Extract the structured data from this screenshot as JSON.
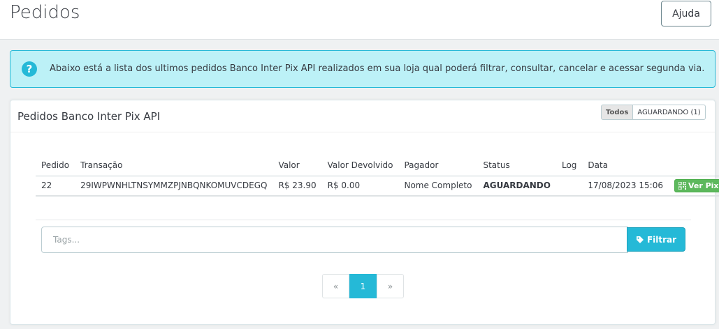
{
  "header": {
    "title": "Pedidos",
    "help_label": "Ajuda"
  },
  "alert": {
    "icon": "question-circle-icon",
    "text": "Abaixo está a lista dos ultimos pedidos Banco Inter Pix API realizados em sua loja qual poderá filtrar, consultar, cancelar e acessar segunda via."
  },
  "panel": {
    "title": "Pedidos Banco Inter Pix API",
    "filters": [
      {
        "label": "Todos",
        "active": true
      },
      {
        "label": "AGUARDANDO (1)",
        "active": false
      }
    ]
  },
  "table": {
    "columns": [
      "Pedido",
      "Transação",
      "Valor",
      "Valor Devolvido",
      "Pagador",
      "Status",
      "Log",
      "Data",
      ""
    ],
    "rows": [
      {
        "pedido": "22",
        "transacao": "29IWPWNHLTNSYMMZPJNBQNKOMUVCDEGQ",
        "valor": "R$ 23.90",
        "valor_devolvido": "R$ 0.00",
        "pagador": "Nome Completo",
        "status": "AGUARDANDO",
        "log": "",
        "data": "17/08/2023 15:06",
        "action_label": "Ver Pix"
      }
    ]
  },
  "search": {
    "placeholder": "Tags...",
    "button_label": "Filtrar"
  },
  "pagination": {
    "prev": "«",
    "current": "1",
    "next": "»"
  },
  "colors": {
    "accent": "#25b9d7",
    "success": "#5cb85c",
    "alert_bg": "#bcf1f7",
    "page_bg": "#eff1f2"
  }
}
